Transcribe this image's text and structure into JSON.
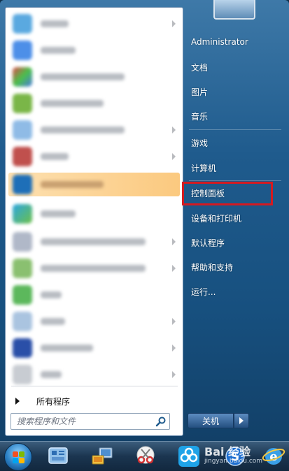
{
  "left_panel": {
    "all_programs": "所有程序",
    "search_placeholder": "搜索程序和文件"
  },
  "right_panel": {
    "items": [
      "Administrator",
      "文档",
      "图片",
      "音乐",
      "游戏",
      "计算机",
      "控制面板",
      "设备和打印机",
      "默认程序",
      "帮助和支持",
      "运行..."
    ]
  },
  "shutdown": {
    "label": "关机"
  },
  "watermark": {
    "logo": "Bai 经验",
    "url": "jingyan.baidu.com"
  },
  "colors": {
    "accent_highlight": "#fbc97f",
    "annotation_box": "#d51a20",
    "frame": "#1f5b8d"
  }
}
